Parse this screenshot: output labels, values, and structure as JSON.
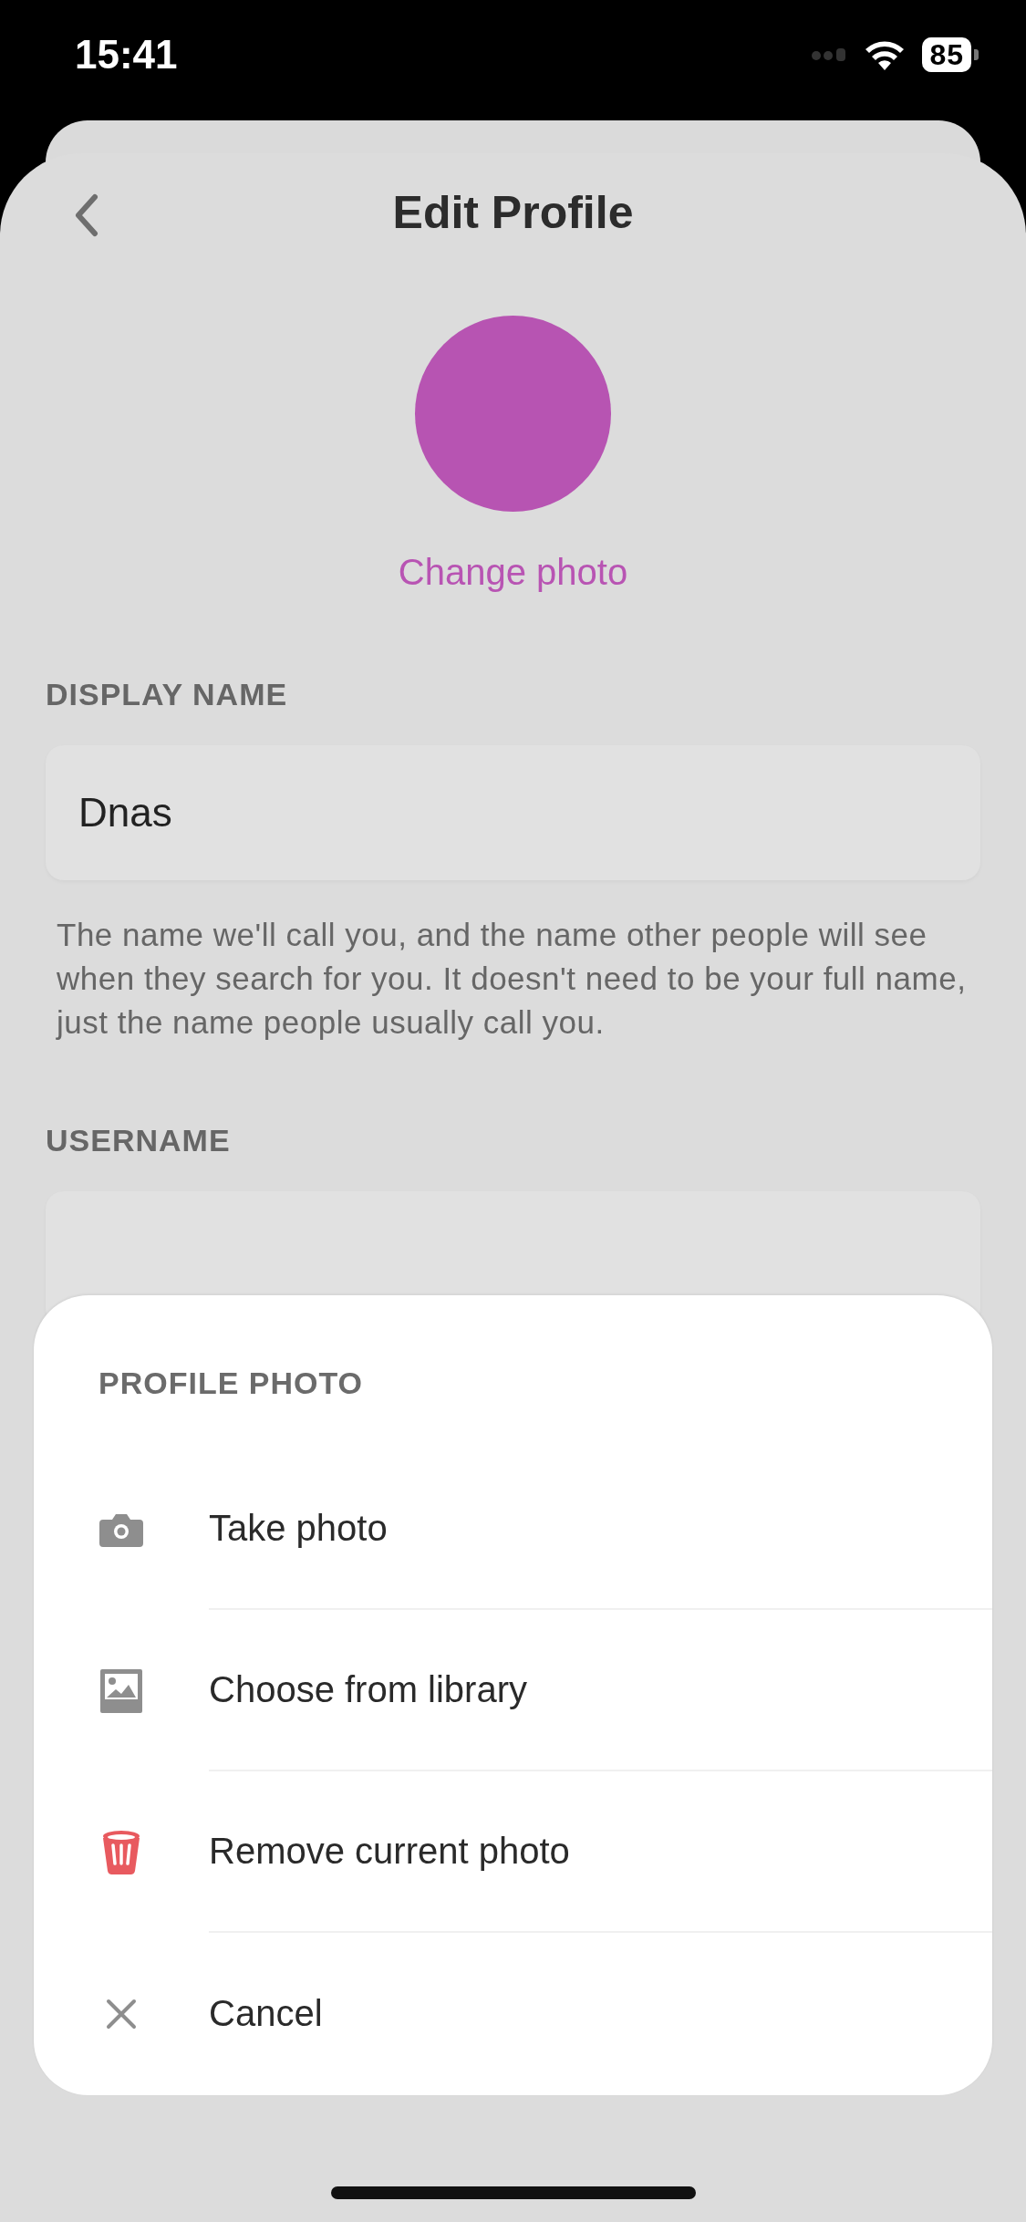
{
  "status_bar": {
    "time": "15:41",
    "battery": "85"
  },
  "header": {
    "title": "Edit Profile"
  },
  "avatar": {
    "color": "#b754b2",
    "action": "Change photo"
  },
  "display_name": {
    "label": "DISPLAY NAME",
    "value": "Dnas",
    "help": "The name we'll call you, and the name other people will see when they search for you. It doesn't need to be your full name, just the name people usually call you."
  },
  "username": {
    "label": "USERNAME"
  },
  "action_sheet": {
    "title": "PROFILE PHOTO",
    "items": [
      {
        "kind": "camera",
        "label": "Take photo"
      },
      {
        "kind": "library",
        "label": "Choose from library"
      },
      {
        "kind": "remove",
        "label": "Remove current photo"
      },
      {
        "kind": "cancel",
        "label": "Cancel"
      }
    ]
  }
}
